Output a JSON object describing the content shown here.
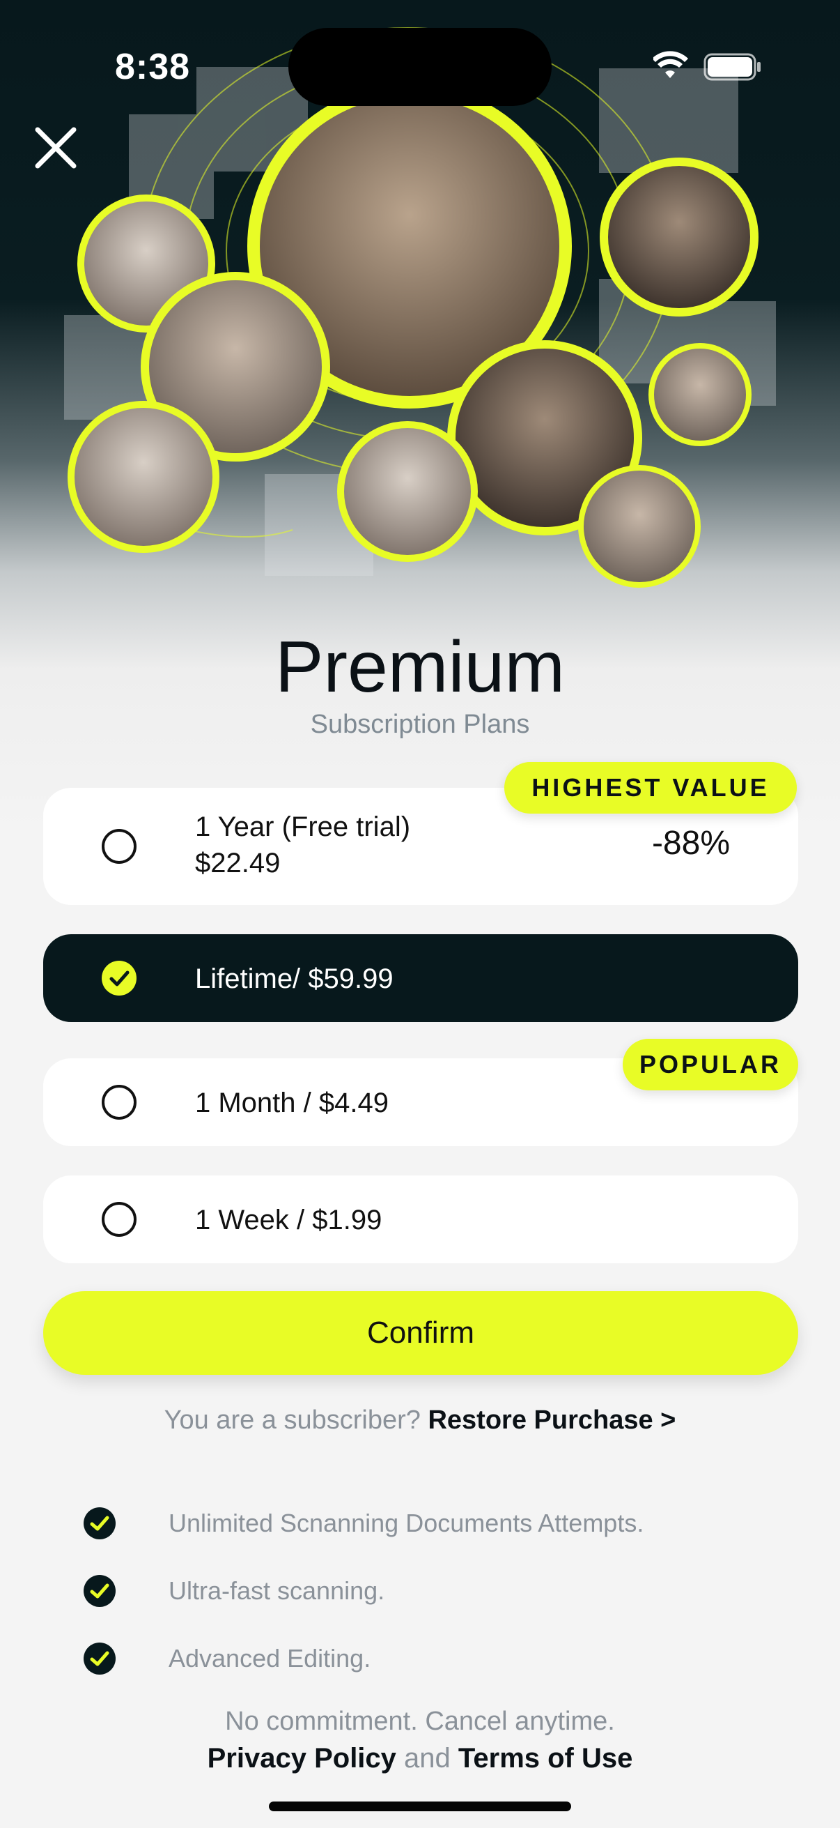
{
  "status_bar": {
    "time": "8:38"
  },
  "header": {
    "title": "Premium",
    "subtitle": "Subscription Plans"
  },
  "plans": [
    {
      "line1": "1 Year (Free trial)",
      "line2": "$22.49",
      "discount": "-88%",
      "badge": "HIGHEST VALUE",
      "selected": false
    },
    {
      "label": "Lifetime/ $59.99",
      "selected": true
    },
    {
      "label": "1 Month / $4.49",
      "badge": "POPULAR",
      "selected": false
    },
    {
      "label": "1 Week / $1.99",
      "selected": false
    }
  ],
  "confirm_label": "Confirm",
  "restore": {
    "prompt": "You are a subscriber?",
    "link": "Restore Purchase >"
  },
  "features": [
    "Unlimited Scnanning Documents Attempts.",
    "Ultra-fast scanning.",
    "Advanced Editing."
  ],
  "footer": {
    "note": "No commitment. Cancel anytime.",
    "privacy": "Privacy Policy",
    "and": "and",
    "terms": "Terms of Use"
  },
  "colors": {
    "accent": "#e8fc26",
    "dark": "#07181c",
    "muted": "#8a9199"
  },
  "icons": {
    "close": "close-icon",
    "wifi": "wifi-icon",
    "battery": "battery-icon",
    "radio": "radio-icon",
    "check": "checkmark-icon"
  }
}
